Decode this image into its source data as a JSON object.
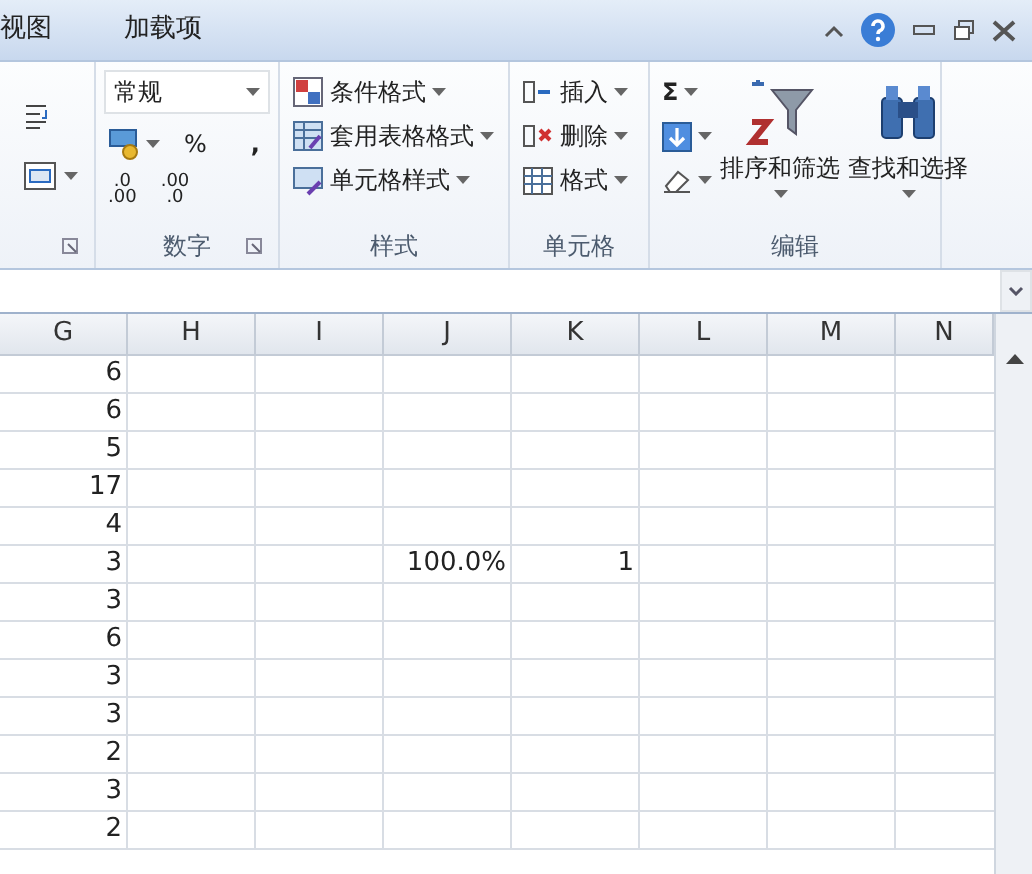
{
  "tabs": [
    {
      "label": "视图",
      "selected": false
    },
    {
      "label": "加载项",
      "selected": false
    }
  ],
  "ribbon": {
    "number": {
      "label": "数字",
      "format": "常规",
      "percent": "%",
      "comma": ",",
      "decimals": [
        {
          "top": ".0",
          "bottom": ".00"
        },
        {
          "top": ".00",
          "bottom": ".0"
        }
      ]
    },
    "styles": {
      "label": "样式",
      "items": [
        "条件格式",
        "套用表格格式",
        "单元格样式"
      ]
    },
    "cells": {
      "label": "单元格",
      "items": [
        "插入",
        "删除",
        "格式"
      ]
    },
    "editing": {
      "label": "编辑",
      "sum": "Σ",
      "sort": "排序和筛选",
      "find": "查找和选择"
    }
  },
  "grid": {
    "columns": [
      "G",
      "H",
      "I",
      "J",
      "K",
      "L",
      "M",
      "N"
    ],
    "rows": [
      {
        "G": "6"
      },
      {
        "G": "6"
      },
      {
        "G": "5"
      },
      {
        "G": "17"
      },
      {
        "G": "4"
      },
      {
        "G": "3",
        "J": "100.0%",
        "K": "1"
      },
      {
        "G": "3"
      },
      {
        "G": "6"
      },
      {
        "G": "3"
      },
      {
        "G": "3"
      },
      {
        "G": "2"
      },
      {
        "G": "3"
      },
      {
        "G": "2"
      }
    ]
  }
}
